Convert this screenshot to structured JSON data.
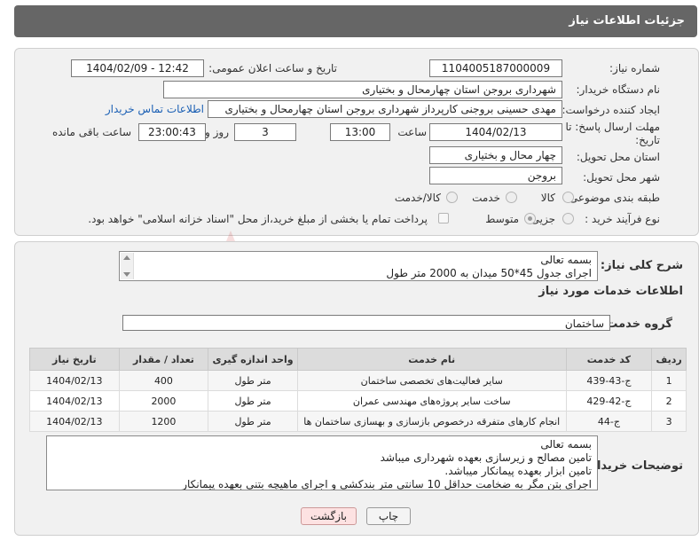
{
  "header": {
    "title": "جزئیات اطلاعات نیاز"
  },
  "form": {
    "need_number_label": "شماره نیاز:",
    "need_number": "1104005187000009",
    "announce_label": "تاریخ و ساعت اعلان عمومی:",
    "announce_value": "1404/02/09 - 12:42",
    "buyer_org_label": "نام دستگاه خریدار:",
    "buyer_org": "شهرداری بروجن استان چهارمحال و بختیاری",
    "requester_label": "ایجاد کننده درخواست:",
    "requester": "مهدی حسینی بروجنی کارپرداز شهرداری بروجن استان چهارمحال و بختیاری",
    "contact_link": "اطلاعات تماس خریدار",
    "deadline_label": "مهلت ارسال پاسخ: تا تاریخ:",
    "deadline_date": "1404/02/13",
    "time_label": "ساعت",
    "deadline_time": "13:00",
    "days_value": "3",
    "days_label": "روز و",
    "remaining_time": "23:00:43",
    "remaining_label": "ساعت باقی مانده",
    "province_label": "استان محل تحویل:",
    "province": "چهار محال و بختیاری",
    "city_label": "شهر محل تحویل:",
    "city": "بروجن",
    "category_label": "طبقه بندی موضوعی:",
    "category_options": [
      "کالا",
      "خدمت",
      "کالا/خدمت"
    ],
    "purchase_type_label": "نوع فرآیند خرید :",
    "purchase_options": [
      "جزیی",
      "متوسط"
    ],
    "treasury_note": "پرداخت تمام یا بخشی از مبلغ خرید،از محل \"اسناد خزانه اسلامی\" خواهد بود."
  },
  "description": {
    "label": "شرح کلی نیاز:",
    "line1": "بسمه تعالی",
    "line2": "اجرای جدول 45*50 میدان به 2000 متر طول"
  },
  "services": {
    "section_title": "اطلاعات خدمات مورد نیاز",
    "group_label": "گروه خدمت:",
    "group_value": "ساختمان",
    "columns": [
      "ردیف",
      "کد خدمت",
      "نام خدمت",
      "واحد اندازه گیری",
      "تعداد / مقدار",
      "تاریخ نیاز"
    ],
    "rows": [
      [
        "1",
        "ج-43-439",
        "سایر فعالیت‌های تخصصی ساختمان",
        "متر طول",
        "400",
        "1404/02/13"
      ],
      [
        "2",
        "ج-42-429",
        "ساخت سایر پروژه‌های مهندسی عمران",
        "متر طول",
        "2000",
        "1404/02/13"
      ],
      [
        "3",
        "ج-44",
        "انجام کارهای متفرقه درخصوص بازسازی و بهسازی ساختمان ها",
        "متر طول",
        "1200",
        "1404/02/13"
      ]
    ]
  },
  "buyer_notes": {
    "label": "توضیحات خریدار:",
    "lines": [
      "بسمه تعالی",
      "تامین مصالح و زیرسازی بعهده شهرداری میباشد",
      "تامین ابزار بعهده پیمانکار میباشد.",
      "اجرای بتن مگر به ضخامت حداقل 10 سانتی متر بندکشی و اجرای ماهیچه بتنی بعهده پیمانکار"
    ]
  },
  "buttons": {
    "print": "چاپ",
    "back": "بازگشت"
  },
  "watermark": {
    "text": "AriaTender.neT"
  },
  "colors": {
    "header_bg": "#666666",
    "link": "#1a5fb4",
    "back_btn_bg": "#fde2e2"
  }
}
